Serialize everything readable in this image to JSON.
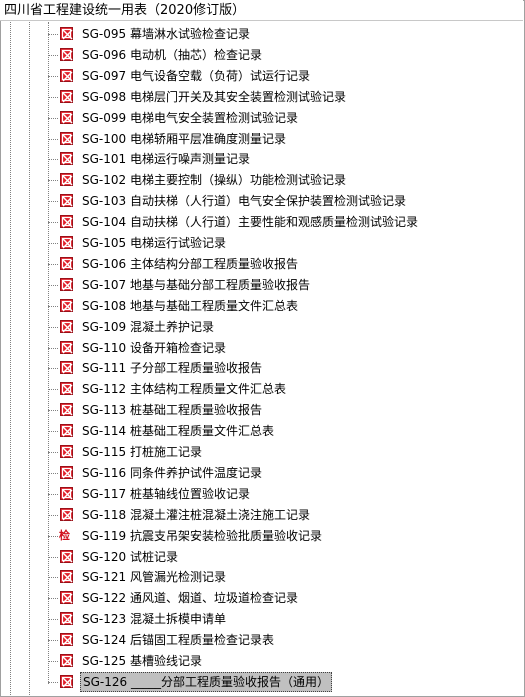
{
  "window": {
    "title": "四川省工程建设统一用表（2020修订版）"
  },
  "tree": {
    "icons": {
      "default": "form-icon",
      "special_text": "检"
    },
    "selected_index": 31,
    "items": [
      {
        "code": "SG-095",
        "label": "SG-095 幕墙淋水试验检查记录",
        "icon": "form-icon"
      },
      {
        "code": "SG-096",
        "label": "SG-096 电动机（抽芯）检查记录",
        "icon": "form-icon"
      },
      {
        "code": "SG-097",
        "label": "SG-097 电气设备空载（负荷）试运行记录",
        "icon": "form-icon"
      },
      {
        "code": "SG-098",
        "label": "SG-098 电梯层门开关及其安全装置检测试验记录",
        "icon": "form-icon"
      },
      {
        "code": "SG-099",
        "label": "SG-099 电梯电气安全装置检测试验记录",
        "icon": "form-icon"
      },
      {
        "code": "SG-100",
        "label": "SG-100 电梯轿厢平层准确度测量记录",
        "icon": "form-icon"
      },
      {
        "code": "SG-101",
        "label": "SG-101 电梯运行噪声测量记录",
        "icon": "form-icon"
      },
      {
        "code": "SG-102",
        "label": "SG-102 电梯主要控制（操纵）功能检测试验记录",
        "icon": "form-icon"
      },
      {
        "code": "SG-103",
        "label": "SG-103 自动扶梯（人行道）电气安全保护装置检测试验记录",
        "icon": "form-icon"
      },
      {
        "code": "SG-104",
        "label": "SG-104 自动扶梯（人行道）主要性能和观感质量检测试验记录",
        "icon": "form-icon"
      },
      {
        "code": "SG-105",
        "label": "SG-105 电梯运行试验记录",
        "icon": "form-icon"
      },
      {
        "code": "SG-106",
        "label": "SG-106 主体结构分部工程质量验收报告",
        "icon": "form-icon"
      },
      {
        "code": "SG-107",
        "label": "SG-107 地基与基础分部工程质量验收报告",
        "icon": "form-icon"
      },
      {
        "code": "SG-108",
        "label": "SG-108 地基与基础工程质量文件汇总表",
        "icon": "form-icon"
      },
      {
        "code": "SG-109",
        "label": "SG-109 混凝土养护记录",
        "icon": "form-icon"
      },
      {
        "code": "SG-110",
        "label": "SG-110 设备开箱检查记录",
        "icon": "form-icon"
      },
      {
        "code": "SG-111",
        "label": "SG-111 子分部工程质量验收报告",
        "icon": "form-icon"
      },
      {
        "code": "SG-112",
        "label": "SG-112 主体结构工程质量文件汇总表",
        "icon": "form-icon"
      },
      {
        "code": "SG-113",
        "label": "SG-113 桩基础工程质量验收报告",
        "icon": "form-icon"
      },
      {
        "code": "SG-114",
        "label": "SG-114 桩基础工程质量文件汇总表",
        "icon": "form-icon"
      },
      {
        "code": "SG-115",
        "label": "SG-115 打桩施工记录",
        "icon": "form-icon"
      },
      {
        "code": "SG-116",
        "label": "SG-116 同条件养护试件温度记录",
        "icon": "form-icon"
      },
      {
        "code": "SG-117",
        "label": "SG-117 桩基轴线位置验收记录",
        "icon": "form-icon"
      },
      {
        "code": "SG-118",
        "label": "SG-118 混凝土灌注桩混凝土浇注施工记录",
        "icon": "form-icon"
      },
      {
        "code": "SG-119",
        "label": "SG-119 抗震支吊架安装检验批质量验收记录",
        "icon": "inspection-text-icon"
      },
      {
        "code": "SG-120",
        "label": "SG-120 试桩记录",
        "icon": "form-icon"
      },
      {
        "code": "SG-121",
        "label": "SG-121 风管漏光检测记录",
        "icon": "form-icon"
      },
      {
        "code": "SG-122",
        "label": "SG-122 通风道、烟道、垃圾道检查记录",
        "icon": "form-icon"
      },
      {
        "code": "SG-123",
        "label": "SG-123 混凝土拆模申请单",
        "icon": "form-icon"
      },
      {
        "code": "SG-124",
        "label": "SG-124 后锚固工程质量检查记录表",
        "icon": "form-icon"
      },
      {
        "code": "SG-125",
        "label": "SG-125 基槽验线记录",
        "icon": "form-icon"
      },
      {
        "code": "SG-126",
        "label": "SG-126 _____分部工程质量验收报告（通用）",
        "icon": "form-icon"
      }
    ]
  }
}
